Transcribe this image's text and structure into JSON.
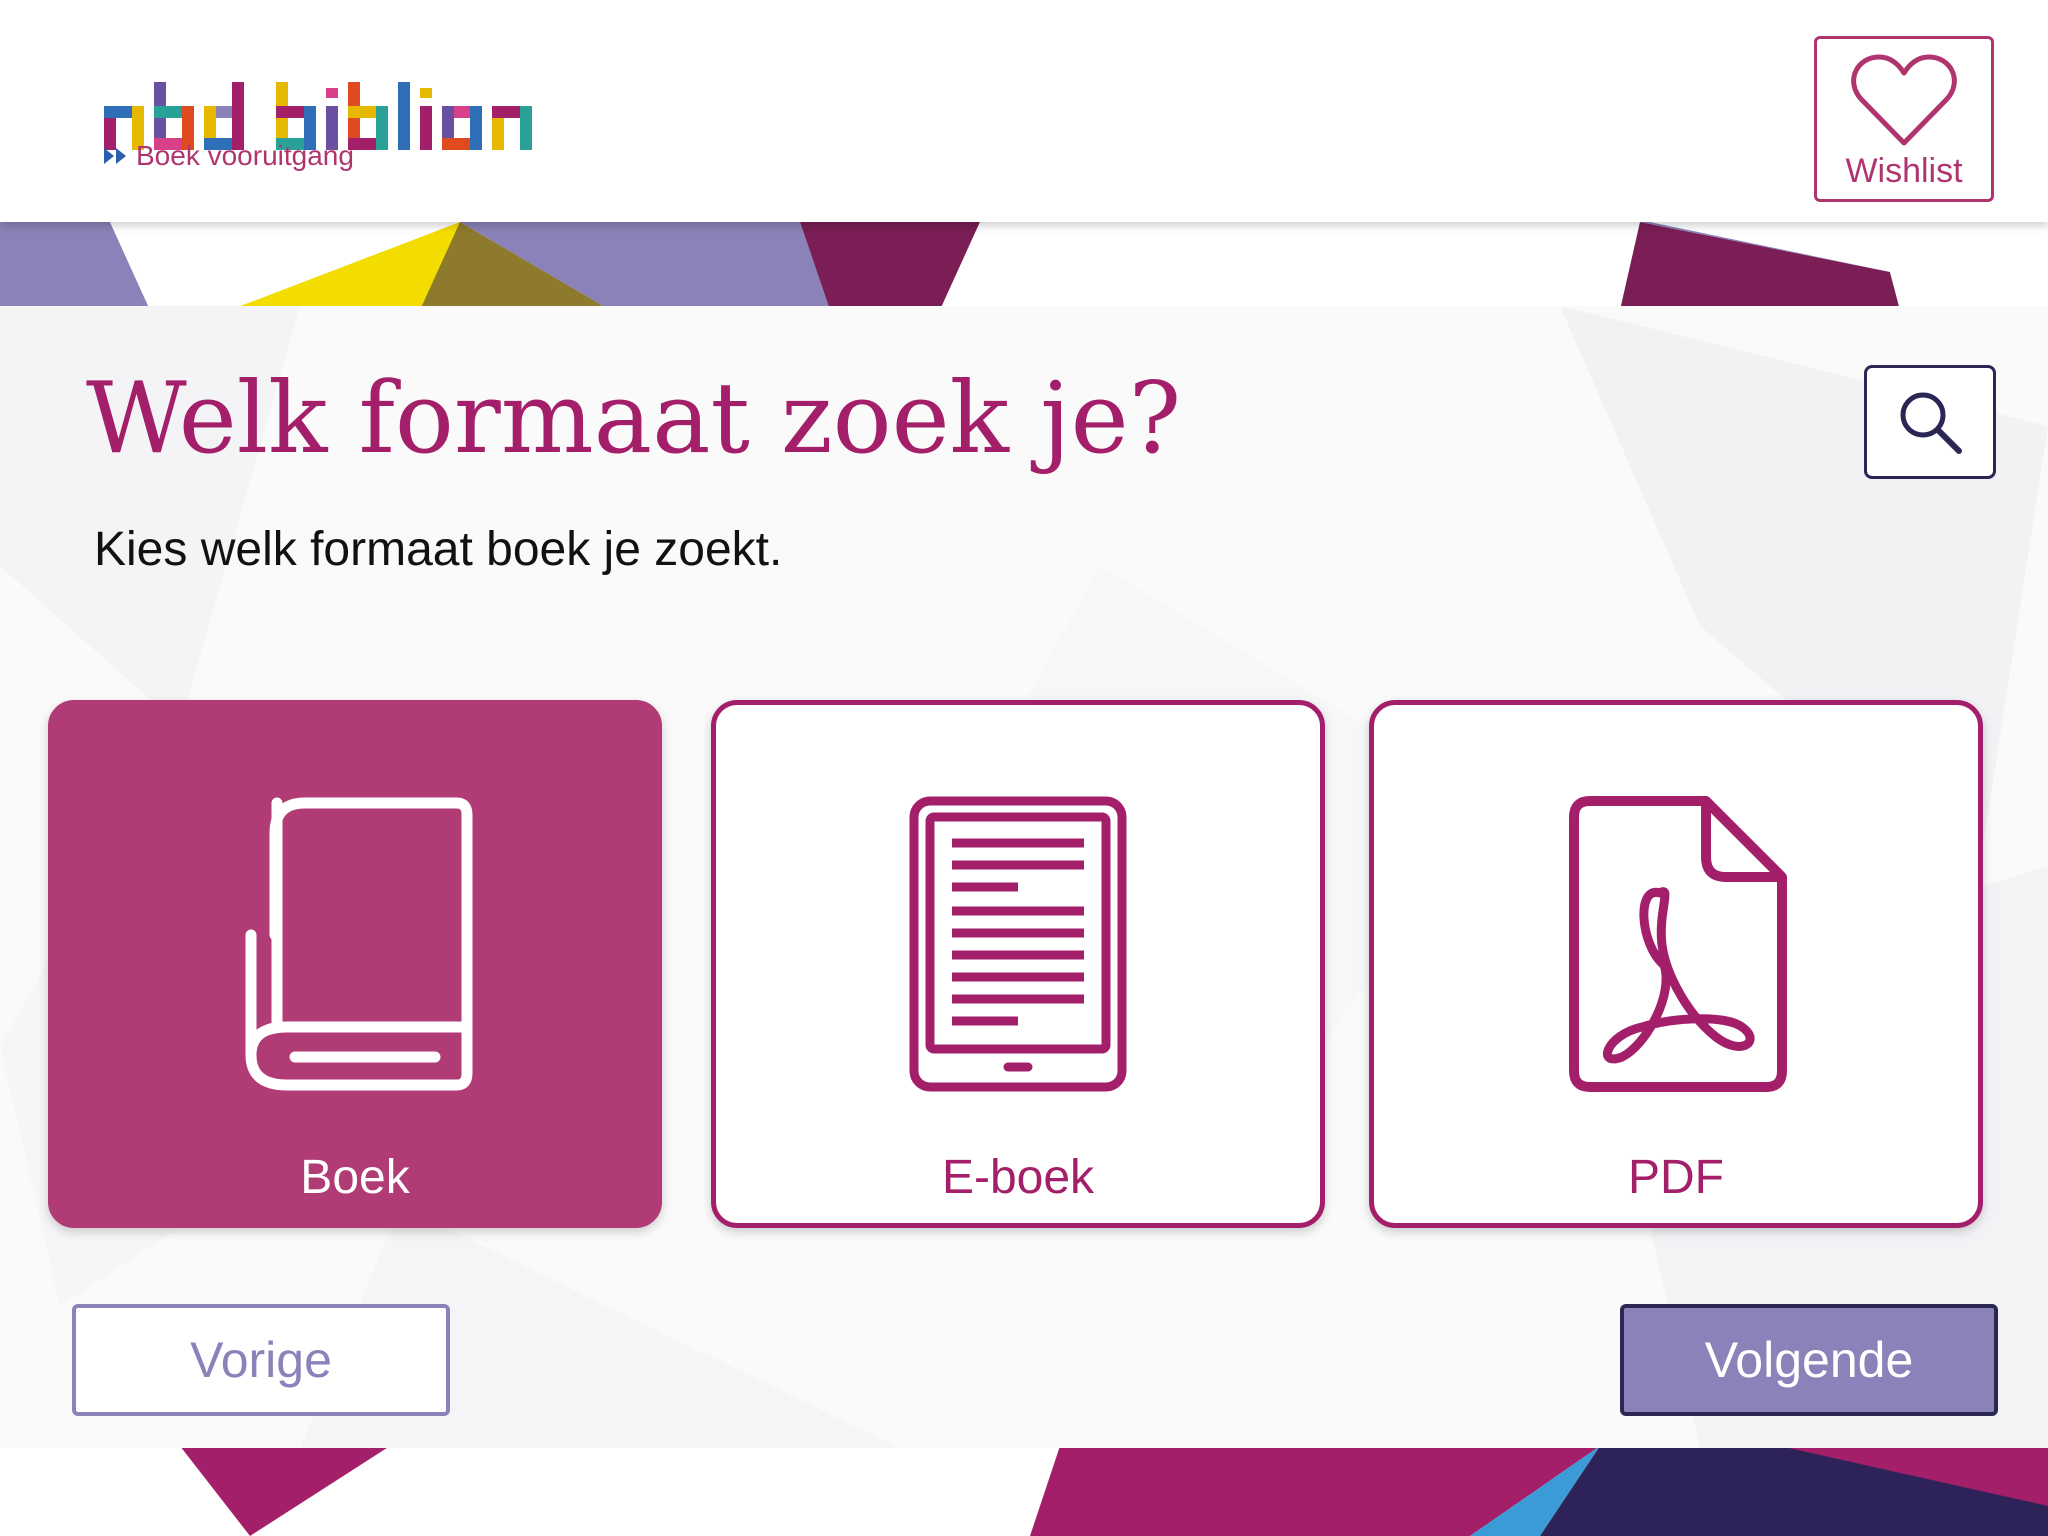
{
  "header": {
    "brand": "nbd biblion",
    "tagline": "Boek vooruitgang",
    "wishlist_label": "Wishlist"
  },
  "page": {
    "title": "Welk formaat zoek je?",
    "subtitle": "Kies welk formaat boek je zoekt."
  },
  "formats": [
    {
      "label": "Boek",
      "icon": "book-icon",
      "selected": true
    },
    {
      "label": "E-boek",
      "icon": "ereader-icon",
      "selected": false
    },
    {
      "label": "PDF",
      "icon": "pdf-file-icon",
      "selected": false
    }
  ],
  "navigation": {
    "prev_label": "Vorige",
    "next_label": "Volgende"
  },
  "colors": {
    "brand_magenta": "#a41f6a",
    "selected_card": "#b03b75",
    "lavender": "#8a82b8",
    "navy": "#2a2755"
  }
}
